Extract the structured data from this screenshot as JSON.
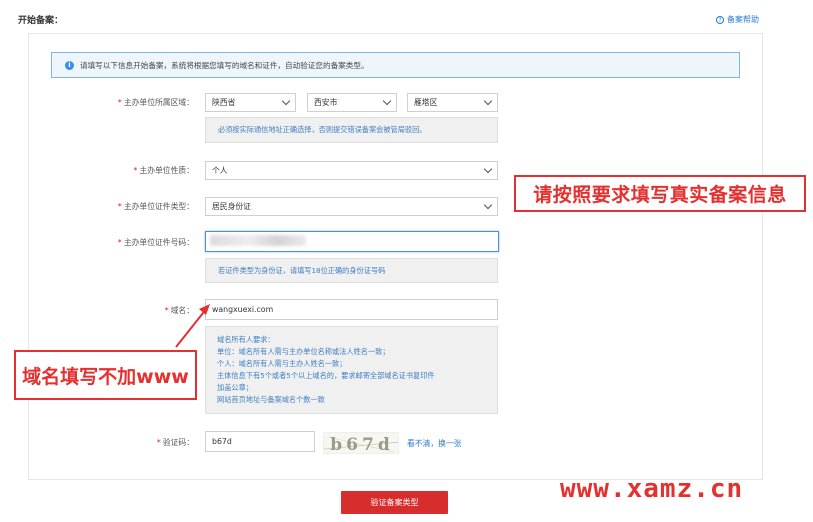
{
  "header": {
    "title": "开始备案：",
    "help_label": "备案帮助",
    "help_icon": "question-circle-icon"
  },
  "notice": {
    "icon": "info-icon",
    "text": "请填写以下信息开始备案，系统将根据您填写的域名和证件，自动验证您的备案类型。"
  },
  "form": {
    "region": {
      "label": "主办单位所属区域：",
      "province": "陕西省",
      "city": "西安市",
      "district": "雁塔区",
      "hint": "必须按实际通信地址正确选择，否则提交错误备案会被管局驳回。"
    },
    "nature": {
      "label": "主办单位性质：",
      "value": "个人"
    },
    "cert_type": {
      "label": "主办单位证件类型：",
      "value": "居民身份证"
    },
    "cert_number": {
      "label": "主办单位证件号码：",
      "value": "",
      "hint": "若证件类型为身份证，请填写18位正确的身份证号码"
    },
    "domain": {
      "label": "域名：",
      "value": "wangxuexi.com",
      "rules": [
        "域名所有人要求：",
        "单位：域名所有人需与主办单位名称或法人姓名一致；",
        "个人：域名所有人需与主办人姓名一致；",
        "主体信息下有5个或者5个以上域名的，要求邮寄全部域名证书复印件",
        "加盖公章；",
        "网站首页地址与备案域名个数一致"
      ]
    },
    "captcha": {
      "label": "验证码：",
      "value": "b67d",
      "image_text": "b67d",
      "refresh_label": "看不清，换一张"
    },
    "required_mark": "*"
  },
  "submit_label": "验证备案类型",
  "annotations": {
    "right": "请按照要求填写真实备案信息",
    "left": "域名填写不加www",
    "color": "#e53030"
  },
  "watermark": "www.xamz.cn",
  "colors": {
    "accent": "#2a7ad6",
    "button": "#d82d2d",
    "hint_text": "#3d7fc6"
  }
}
